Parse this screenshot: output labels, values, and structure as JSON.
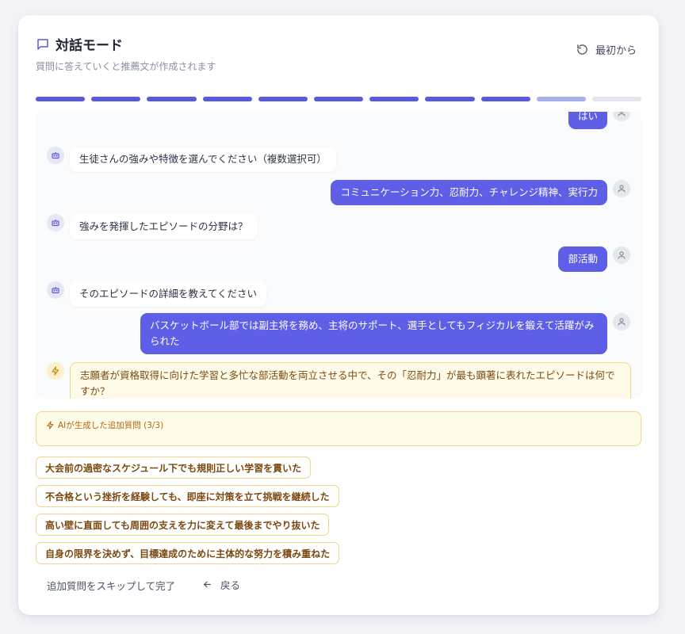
{
  "header": {
    "title": "対話モード",
    "subtitle": "質問に答えていくと推薦文が作成されます",
    "restart_label": "最初から",
    "title_icon": "chat-bubble-icon",
    "restart_icon": "rotate-ccw-icon"
  },
  "progress": {
    "total_steps": 11,
    "completed_steps": 9,
    "current_step": 10,
    "colors": {
      "done": "#5b5bd6",
      "current": "#a8b0e6",
      "pending": "#e4e6ef"
    }
  },
  "chat": {
    "messages": [
      {
        "role": "user",
        "text": "はい"
      },
      {
        "role": "bot",
        "text": "生徒さんの強みや特徴を選んでください（複数選択可）"
      },
      {
        "role": "user",
        "text": "コミュニケーション力、忍耐力、チャレンジ精神、実行力"
      },
      {
        "role": "bot",
        "text": "強みを発揮したエピソードの分野は？"
      },
      {
        "role": "user",
        "text": "部活動"
      },
      {
        "role": "bot",
        "text": "そのエピソードの詳細を教えてください"
      },
      {
        "role": "user",
        "text": "バスケットボール部では副主将を務め、主将のサポート、選手としてもフィジカルを鍛えて活躍がみられた"
      },
      {
        "role": "ai",
        "text": "志願者が資格取得に向けた学習と多忙な部活動を両立させる中で、その「忍耐力」が最も顕著に表れたエピソードは何ですか？"
      }
    ]
  },
  "ai_notice": {
    "text": "AIが生成した追加質問 (3/3)",
    "icon": "sparkle-icon"
  },
  "choices": [
    "大会前の過密なスケジュール下でも規則正しい学習を貫いた",
    "不合格という挫折を経験しても、即座に対策を立て挑戦を継続した",
    "高い壁に直面しても周囲の支えを力に変えて最後までやり抜いた",
    "自身の限界を決めず、目標達成のために主体的な努力を積み重ねた"
  ],
  "footer": {
    "skip_label": "追加質問をスキップして完了",
    "back_label": "戻る",
    "back_icon": "arrow-left-icon"
  },
  "colors": {
    "accent": "#5b5bd6",
    "user_bubble": "#5f5ee6",
    "ai_bubble_bg": "#fffbe9",
    "ai_border": "#f2d883",
    "ai_text": "#7a4a10"
  }
}
